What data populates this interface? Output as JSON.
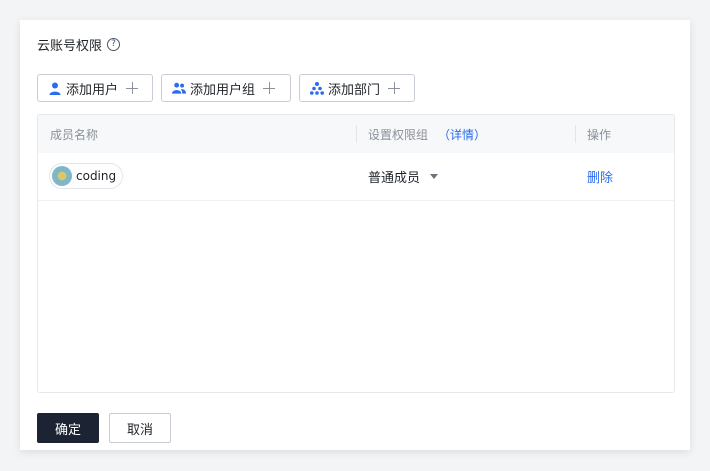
{
  "panel": {
    "title": "云账号权限",
    "help_icon": "?"
  },
  "toolbar": {
    "add_user_label": "添加用户",
    "add_group_label": "添加用户组",
    "add_dept_label": "添加部门"
  },
  "table": {
    "columns": {
      "member_name": "成员名称",
      "permission_group": "设置权限组",
      "detail_link": "（详情）",
      "action": "操作"
    },
    "rows": [
      {
        "member": "coding",
        "role": "普通成员",
        "action": "删除"
      }
    ]
  },
  "footer": {
    "confirm_label": "确定",
    "cancel_label": "取消"
  },
  "colors": {
    "link": "#2a6bf2",
    "primary_button": "#1c2433",
    "icon_blue": "#2a6bf2"
  },
  "icons": {
    "title_help": "help-circle-icon",
    "user": "user-icon",
    "users": "users-icon",
    "org": "org-tree-icon",
    "plus": "plus-icon",
    "caret": "caret-down-icon"
  }
}
